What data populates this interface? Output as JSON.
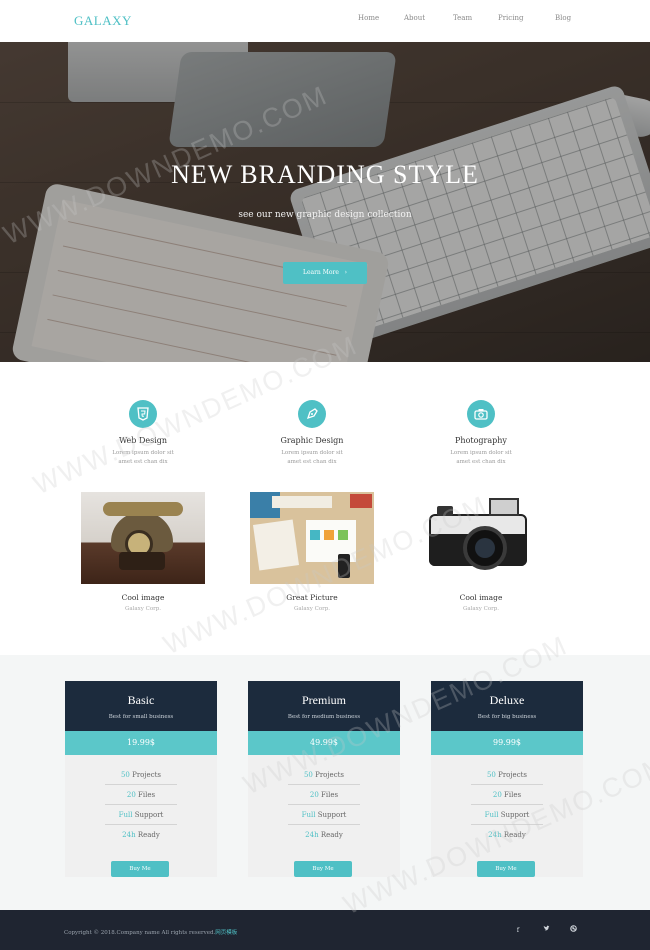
{
  "brand": {
    "name": "GALAXY",
    "accent": "#4fc0c5",
    "dark": "#1c2b3d"
  },
  "nav": {
    "items": [
      "Home",
      "About",
      "Team",
      "Pricing",
      "Blog"
    ]
  },
  "hero": {
    "title": "NEW BRANDING STYLE",
    "subtitle": "see our new graphic design collection",
    "button": "Learn More"
  },
  "services": [
    {
      "icon": "html5-icon",
      "title": "Web Design",
      "desc": "Lorem ipsum dolor sit amet est chan dix"
    },
    {
      "icon": "pen-tool-icon",
      "title": "Graphic Design",
      "desc": "Lorem ipsum dolor sit amet est chan dix"
    },
    {
      "icon": "camera-icon",
      "title": "Photography",
      "desc": "Lorem ipsum dolor sit amet est chan dix"
    }
  ],
  "gallery": [
    {
      "title": "Cool image",
      "sub": "Galaxy Corp."
    },
    {
      "title": "Great Picture",
      "sub": "Galaxy Corp."
    },
    {
      "title": "Cool image",
      "sub": "Galaxy Corp."
    }
  ],
  "pricing": [
    {
      "name": "Basic",
      "tagline": "Best for small business",
      "price": "19.99$",
      "features": [
        {
          "num": "50",
          "label": "Projects"
        },
        {
          "num": "20",
          "label": "Files"
        },
        {
          "num": "Full",
          "label": "Support"
        },
        {
          "num": "24h",
          "label": "Ready"
        }
      ],
      "button": "Buy Me"
    },
    {
      "name": "Premium",
      "tagline": "Best for medium business",
      "price": "49.99$",
      "features": [
        {
          "num": "50",
          "label": "Projects"
        },
        {
          "num": "20",
          "label": "Files"
        },
        {
          "num": "Full",
          "label": "Support"
        },
        {
          "num": "24h",
          "label": "Ready"
        }
      ],
      "button": "Buy Me"
    },
    {
      "name": "Deluxe",
      "tagline": "Best for big business",
      "price": "99.99$",
      "features": [
        {
          "num": "50",
          "label": "Projects"
        },
        {
          "num": "20",
          "label": "Files"
        },
        {
          "num": "Full",
          "label": "Support"
        },
        {
          "num": "24h",
          "label": "Ready"
        }
      ],
      "button": "Buy Me"
    }
  ],
  "footer": {
    "copyright": "Copyright © 2018.Company name All rights reserved.",
    "link": "网页模板",
    "social": [
      "facebook-icon",
      "twitter-icon",
      "dribbble-icon"
    ]
  },
  "watermark": "WWW.DOWNDEMO.COM"
}
